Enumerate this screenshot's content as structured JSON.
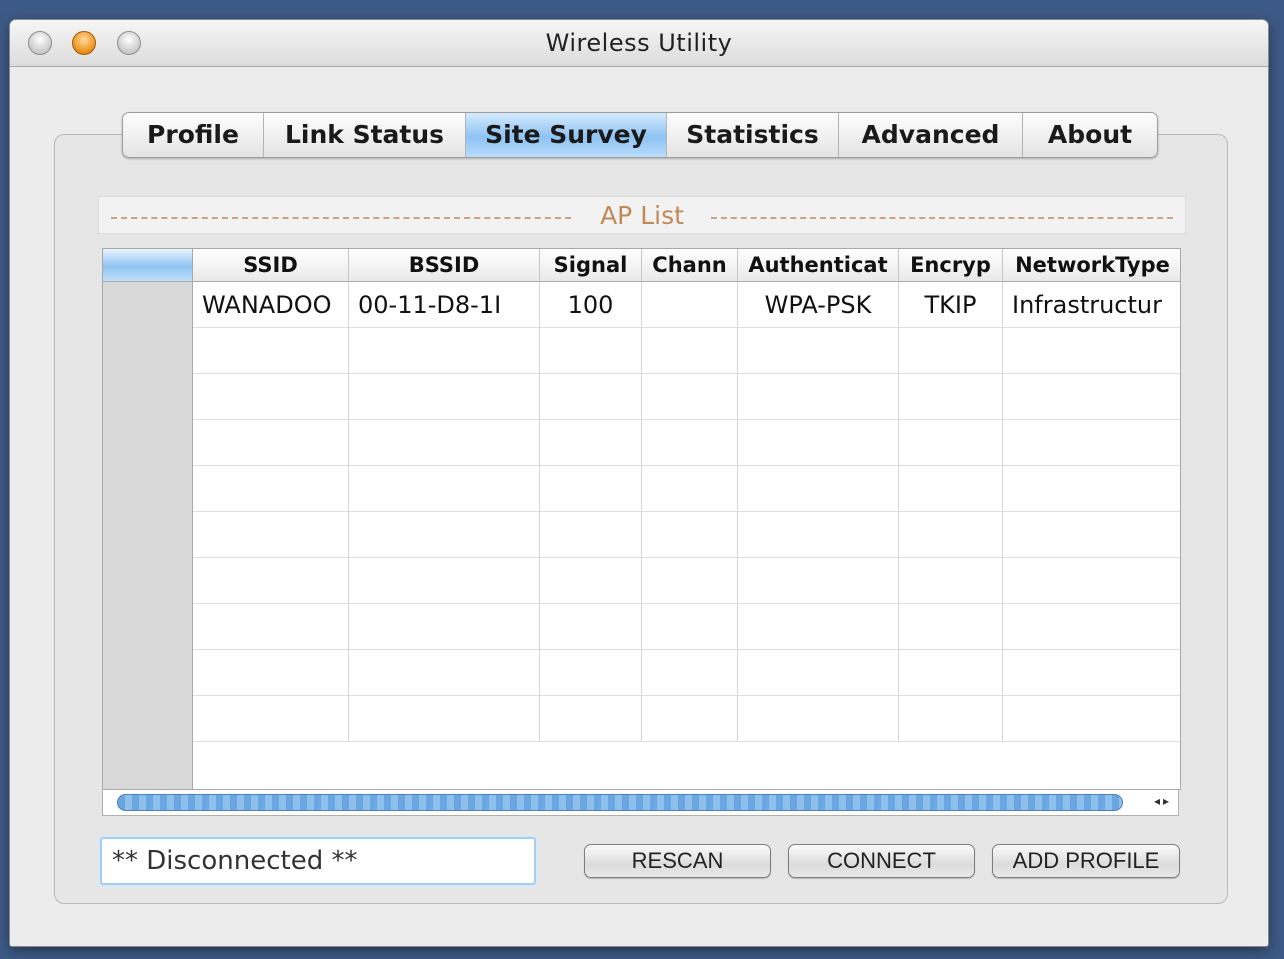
{
  "window": {
    "title": "Wireless Utility"
  },
  "tabs": [
    {
      "label": "Profile",
      "active": false
    },
    {
      "label": "Link Status",
      "active": false
    },
    {
      "label": "Site Survey",
      "active": true
    },
    {
      "label": "Statistics",
      "active": false
    },
    {
      "label": "Advanced",
      "active": false
    },
    {
      "label": "About",
      "active": false
    }
  ],
  "ap_list": {
    "title": "AP List",
    "columns": [
      "SSID",
      "BSSID",
      "Signal",
      "Chann",
      "Authenticat",
      "Encryp",
      "NetworkType"
    ],
    "rows": [
      [
        "WANADOO",
        "00-11-D8-1I",
        "100",
        "",
        "WPA-PSK",
        "TKIP",
        "Infrastructur"
      ]
    ],
    "total_visible_rows": 10
  },
  "status": {
    "text": "** Disconnected **"
  },
  "buttons": {
    "rescan": "RESCAN",
    "connect": "CONNECT",
    "add_profile": "ADD PROFILE"
  },
  "colors": {
    "accent_selected_tab": "#8ec3f2",
    "scroll_thumb": "#6aa6e0",
    "ap_list_label": "#c08a58"
  },
  "icons": [
    "close-button-icon",
    "minimize-button-icon",
    "zoom-button-icon",
    "scroll-left-arrow-icon",
    "scroll-right-arrow-icon"
  ]
}
